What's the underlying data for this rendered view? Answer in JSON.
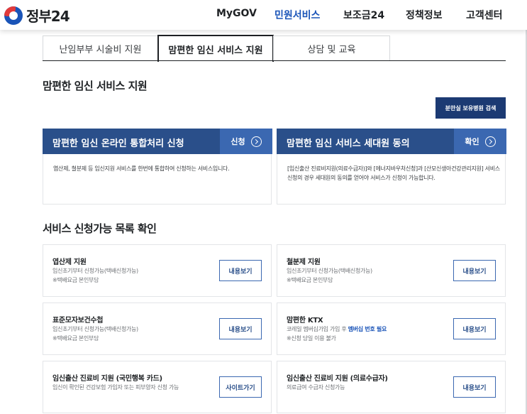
{
  "header": {
    "logo_text": "정부24",
    "nav": [
      "MyGOV",
      "민원서비스",
      "보조금24",
      "정책정보",
      "고객센터"
    ]
  },
  "tabs": [
    "난임부부 시술비 지원",
    "맘편한 임신 서비스 지원",
    "상담 및 교육"
  ],
  "section_title": "맘편한 임신 서비스 지원",
  "search_button": "분만실 보유병원 검색",
  "panels": [
    {
      "title": "맘편한 임신 온라인 통합처리 신청",
      "action": "신청",
      "desc": "엽산제, 철분제 등 임신지원 서비스를 한번에 통합하여 신청하는 서비스입니다."
    },
    {
      "title": "맘편한 임신 서비스 세대원 동의",
      "action": "확인",
      "desc": "[임신출산 진료비지원(의료수급자)]와 [에너지바우처신청]과 [산모신생아건강관리지원] 서비스 신청의 경우 세대원의 동의를 얻어야 서비스가 신청이 가능합니다."
    }
  ],
  "list_title": "서비스 신청가능 목록 확인",
  "cards": [
    {
      "title": "엽산제 지원",
      "line1": "임신초기부터 신청가능(택배신청가능)",
      "line1_hl": "",
      "line2": "※택배요금 본인부담",
      "button": "내용보기"
    },
    {
      "title": "철분제 지원",
      "line1": "임신초기부터 신청가능(택배신청가능)",
      "line1_hl": "",
      "line2": "※택배요금 본인부담",
      "button": "내용보기"
    },
    {
      "title": "표준모자보건수첩",
      "line1": "임신초기부터 신청가능(택배신청가능)",
      "line1_hl": "",
      "line2": "※택배요금 본인부담",
      "button": "내용보기"
    },
    {
      "title": "맘편한 KTX",
      "line1": "코레일 멤버십가입 가입 후 ",
      "line1_hl": "멤버십 번호 필요",
      "line2": "※신청 당일 이용 불가",
      "button": "내용보기"
    },
    {
      "title": "임신출산 진료비 지원 (국민행복 카드)",
      "line1": "임신이 확인된 건강보험 가입자 또는 피부양자 신청 가능",
      "line1_hl": "",
      "line2": "",
      "button": "사이트가기"
    },
    {
      "title": "임신출산 진료비 지원 (의료수급자)",
      "line1": "의료급여 수급자 신청가능",
      "line1_hl": "",
      "line2": "",
      "button": "내용보기"
    }
  ]
}
